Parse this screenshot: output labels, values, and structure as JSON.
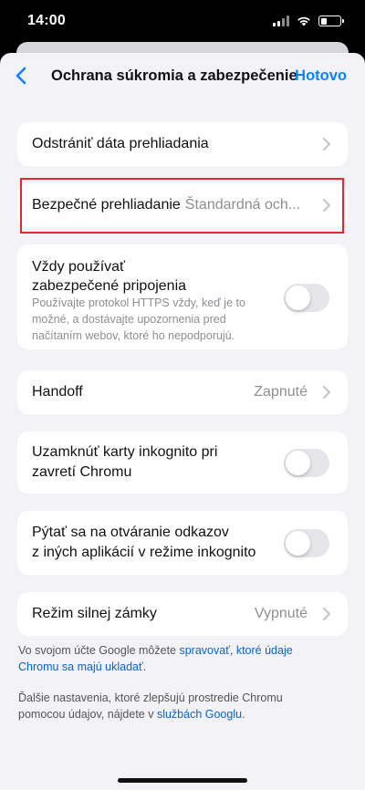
{
  "status_bar": {
    "time": "14:00"
  },
  "nav": {
    "title": "Ochrana súkromia a zabezpečenie",
    "done_label": "Hotovo"
  },
  "rows": {
    "clear_data": {
      "label": "Odstrániť dáta prehliadania"
    },
    "safe_browsing": {
      "label": "Bezpečné prehliadanie",
      "value": "Štandardná och..."
    },
    "https": {
      "label_line1": "Vždy používať",
      "label_line2": "zabezpečené pripojenia",
      "desc_line1": "Používajte protokol HTTPS vždy, keď je to",
      "desc_line2": "možné, a dostávajte upozornenia pred",
      "desc_line3": "načítaním webov, ktoré ho nepodporujú.",
      "enabled": false
    },
    "handoff": {
      "label": "Handoff",
      "value": "Zapnuté"
    },
    "lock_incognito": {
      "label_line1": "Uzamknúť karty inkognito pri",
      "label_line2": "zavretí Chromu",
      "enabled": false
    },
    "ask_links": {
      "label_line1": "Pýtať sa na otváranie odkazov",
      "label_line2": "z iných aplikácií v režime inkognito",
      "enabled": false
    },
    "lockdown": {
      "label": "Režim silnej zámky",
      "value": "Vypnuté"
    }
  },
  "footer": {
    "p1_text": "Vo svojom účte Google môžete ",
    "p1_link_line1": "spravovať, ktoré údaje",
    "p1_link_line2": "Chromu sa majú ukladať",
    "p1_end": ".",
    "p2_line1": "Ďalšie nastavenia, ktoré zlepšujú prostredie Chromu",
    "p2_text": "pomocou údajov, nájdete v ",
    "p2_link": "službách Googlu",
    "p2_end": "."
  },
  "colors": {
    "accent": "#0a84ff",
    "highlight": "#e0282e",
    "background": "#f2f2f7",
    "toggle_off": "#e5e5ea"
  }
}
